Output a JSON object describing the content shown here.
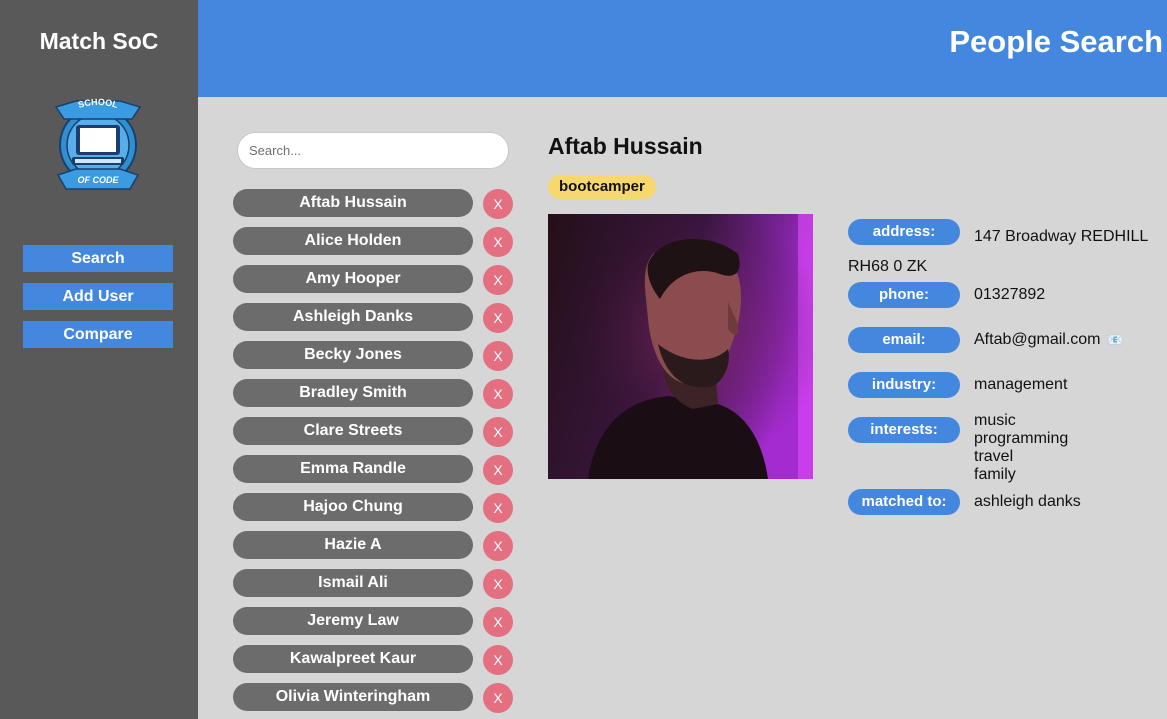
{
  "sidebar": {
    "title": "Match SoC",
    "logo": {
      "top_text": "SCHOOL",
      "bottom_text": "OF CODE"
    },
    "nav": [
      {
        "label": "Search"
      },
      {
        "label": "Add User"
      },
      {
        "label": "Compare"
      }
    ]
  },
  "header": {
    "title": "People Search"
  },
  "search": {
    "placeholder": "Search...",
    "value": ""
  },
  "people": [
    "Aftab Hussain",
    "Alice Holden",
    "Amy Hooper",
    "Ashleigh Danks",
    "Becky Jones",
    "Bradley Smith",
    "Clare Streets",
    "Emma Randle",
    "Hajoo Chung",
    "Hazie A",
    "Ismail Ali",
    "Jeremy Law",
    "Kawalpreet Kaur",
    "Olivia Winteringham"
  ],
  "delete_label": "X",
  "detail": {
    "name": "Aftab Hussain",
    "role": "bootcamper",
    "address_label": "address:",
    "address": "147 Broadway REDHILL RH68 0 ZK",
    "phone_label": "phone:",
    "phone": "01327892",
    "email_label": "email:",
    "email": "Aftab@gmail.com",
    "email_icon": "📧",
    "industry_label": "industry:",
    "industry": "management",
    "interests_label": "interests:",
    "interests": [
      "music",
      "programming",
      "travel",
      "family"
    ],
    "matched_label": "matched to:",
    "matched": "ashleigh danks"
  },
  "colors": {
    "sidebar": "#595959",
    "accent": "#4387df",
    "background": "#d6d6d6",
    "pill": "#6c6c6c",
    "delete": "#e46f80",
    "badge": "#f6d86e"
  }
}
